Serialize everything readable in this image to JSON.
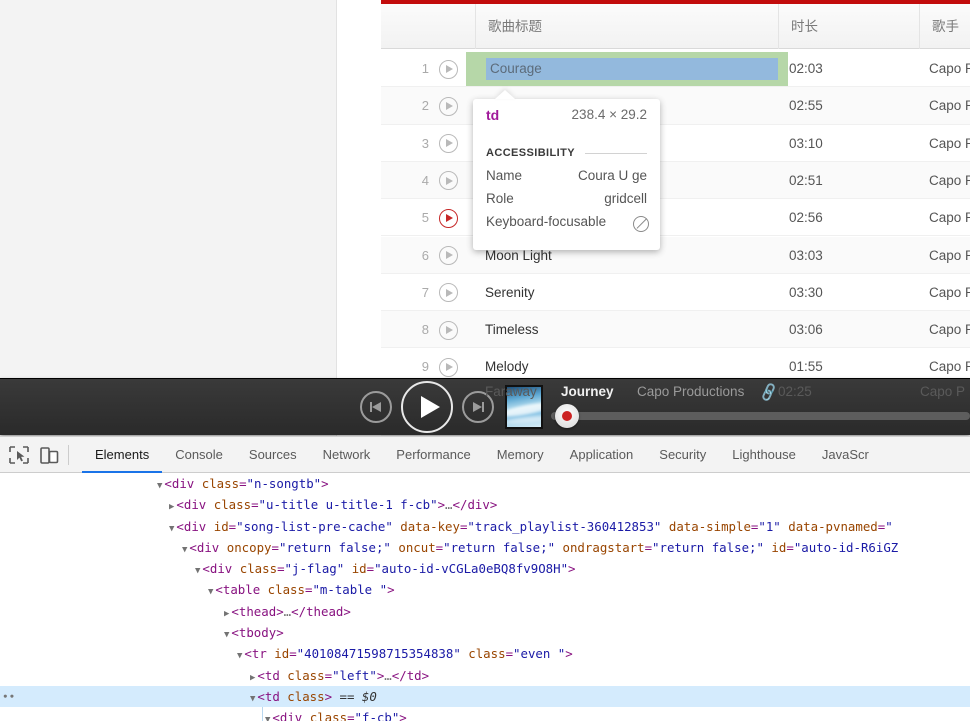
{
  "page": {
    "accent_red": "#c20c0c",
    "table": {
      "columns": [
        "",
        "歌曲标题",
        "时长",
        "歌手"
      ],
      "rows": [
        {
          "index": "1",
          "title": "Courage",
          "time": "02:03",
          "artist": "Capo P",
          "playing": false
        },
        {
          "index": "2",
          "title": "",
          "time": "02:55",
          "artist": "Capo P",
          "playing": false
        },
        {
          "index": "3",
          "title": "",
          "time": "03:10",
          "artist": "Capo P",
          "playing": false
        },
        {
          "index": "4",
          "title": "",
          "time": "02:51",
          "artist": "Capo P",
          "playing": false
        },
        {
          "index": "5",
          "title": "",
          "time": "02:56",
          "artist": "Capo P",
          "playing": true
        },
        {
          "index": "6",
          "title": "Moon Light",
          "time": "03:03",
          "artist": "Capo P",
          "playing": false
        },
        {
          "index": "7",
          "title": "Serenity",
          "time": "03:30",
          "artist": "Capo P",
          "playing": false
        },
        {
          "index": "8",
          "title": "Timeless",
          "time": "03:06",
          "artist": "Capo P",
          "playing": false
        },
        {
          "index": "9",
          "title": "Melody",
          "time": "01:55",
          "artist": "Capo P",
          "playing": false
        }
      ],
      "obscured_row": {
        "title": "Faraway",
        "time": "02:25",
        "artist": "Capo P"
      }
    },
    "highlight": {
      "selected_cell_text": "Courage",
      "padding_color": "#b6d7a8",
      "content_color": "#93b9dd"
    }
  },
  "tooltip": {
    "tag": "td",
    "dimensions": "238.4 × 29.2",
    "section_label": "ACCESSIBILITY",
    "rows": [
      {
        "key": "Name",
        "value": "Coura U ge"
      },
      {
        "key": "Role",
        "value": "gridcell"
      },
      {
        "key": "Keyboard-focusable",
        "value": ""
      }
    ]
  },
  "player": {
    "prev_label": "previous-track",
    "play_label": "play",
    "next_label": "next-track",
    "now_playing_title": "Journey",
    "now_playing_artist": "Capo Productions",
    "link_icon": "🔗"
  },
  "devtools": {
    "icons": [
      "inspect-element-icon",
      "device-toolbar-icon"
    ],
    "tabs": [
      {
        "label": "Elements",
        "active": true
      },
      {
        "label": "Console",
        "active": false
      },
      {
        "label": "Sources",
        "active": false
      },
      {
        "label": "Network",
        "active": false
      },
      {
        "label": "Performance",
        "active": false
      },
      {
        "label": "Memory",
        "active": false
      },
      {
        "label": "Application",
        "active": false
      },
      {
        "label": "Security",
        "active": false
      },
      {
        "label": "Lighthouse",
        "active": false
      },
      {
        "label": "JavaScr",
        "active": false
      }
    ],
    "dom_lines": [
      {
        "indent": 157,
        "twisty": "open",
        "html": "<span class=\"punc\">&lt;</span><span class=\"tag\">div</span> <span class=\"attr\">class</span><span class=\"punc\">=</span><span class=\"val\">\"n-songtb\"</span><span class=\"punc\">&gt;</span>",
        "selected": false,
        "gut": ""
      },
      {
        "indent": 169,
        "twisty": "closed",
        "html": "<span class=\"punc\">&lt;</span><span class=\"tag\">div</span> <span class=\"attr\">class</span><span class=\"punc\">=</span><span class=\"val\">\"u-title u-title-1 f-cb\"</span><span class=\"punc\">&gt;</span><span class=\"ell\">…</span><span class=\"punc\">&lt;/</span><span class=\"tag\">div</span><span class=\"punc\">&gt;</span>",
        "selected": false,
        "gut": ""
      },
      {
        "indent": 169,
        "twisty": "open",
        "html": "<span class=\"punc\">&lt;</span><span class=\"tag\">div</span> <span class=\"attr\">id</span><span class=\"punc\">=</span><span class=\"val\">\"song-list-pre-cache\"</span> <span class=\"attr\">data-key</span><span class=\"punc\">=</span><span class=\"val\">\"track_playlist-360412853\"</span> <span class=\"attr\">data-simple</span><span class=\"punc\">=</span><span class=\"val\">\"1\"</span> <span class=\"attr\">data-pvnamed</span><span class=\"punc\">=</span><span class=\"val\">\"</span>",
        "selected": false,
        "gut": ""
      },
      {
        "indent": 182,
        "twisty": "open",
        "html": "<span class=\"punc\">&lt;</span><span class=\"tag\">div</span> <span class=\"attr\">oncopy</span><span class=\"punc\">=</span><span class=\"val\">\"return false;\"</span> <span class=\"attr\">oncut</span><span class=\"punc\">=</span><span class=\"val\">\"return false;\"</span> <span class=\"attr\">ondragstart</span><span class=\"punc\">=</span><span class=\"val\">\"return false;\"</span> <span class=\"attr\">id</span><span class=\"punc\">=</span><span class=\"val\">\"auto-id-R6iGZ</span>",
        "selected": false,
        "gut": ""
      },
      {
        "indent": 195,
        "twisty": "open",
        "html": "<span class=\"punc\">&lt;</span><span class=\"tag\">div</span> <span class=\"attr\">class</span><span class=\"punc\">=</span><span class=\"val\">\"j-flag\"</span> <span class=\"attr\">id</span><span class=\"punc\">=</span><span class=\"val\">\"auto-id-vCGLa0eBQ8fv9O8H\"</span><span class=\"punc\">&gt;</span>",
        "selected": false,
        "gut": ""
      },
      {
        "indent": 208,
        "twisty": "open",
        "html": "<span class=\"punc\">&lt;</span><span class=\"tag\">table</span> <span class=\"attr\">class</span><span class=\"punc\">=</span><span class=\"val\">\"m-table \"</span><span class=\"punc\">&gt;</span>",
        "selected": false,
        "gut": ""
      },
      {
        "indent": 224,
        "twisty": "closed",
        "html": "<span class=\"punc\">&lt;</span><span class=\"tag\">thead</span><span class=\"punc\">&gt;</span><span class=\"ell\">…</span><span class=\"punc\">&lt;/</span><span class=\"tag\">thead</span><span class=\"punc\">&gt;</span>",
        "selected": false,
        "gut": ""
      },
      {
        "indent": 224,
        "twisty": "open",
        "html": "<span class=\"punc\">&lt;</span><span class=\"tag\">tbody</span><span class=\"punc\">&gt;</span>",
        "selected": false,
        "gut": ""
      },
      {
        "indent": 237,
        "twisty": "open",
        "html": "<span class=\"punc\">&lt;</span><span class=\"tag\">tr</span> <span class=\"attr\">id</span><span class=\"punc\">=</span><span class=\"val\">\"40108471598715354838\"</span> <span class=\"attr\">class</span><span class=\"punc\">=</span><span class=\"val\">\"even \"</span><span class=\"punc\">&gt;</span>",
        "selected": false,
        "gut": ""
      },
      {
        "indent": 250,
        "twisty": "closed",
        "html": "<span class=\"punc\">&lt;</span><span class=\"tag\">td</span> <span class=\"attr\">class</span><span class=\"punc\">=</span><span class=\"val\">\"left\"</span><span class=\"punc\">&gt;</span><span class=\"ell\">…</span><span class=\"punc\">&lt;/</span><span class=\"tag\">td</span><span class=\"punc\">&gt;</span>",
        "selected": false,
        "gut": ""
      },
      {
        "indent": 250,
        "twisty": "open",
        "html": "<span class=\"punc\">&lt;</span><span class=\"tag\">td</span> <span class=\"attr\">class</span><span class=\"punc\">&gt;</span> <span class=\"dollar\">== $0</span>",
        "selected": true,
        "gut": "∙∙"
      },
      {
        "indent": 265,
        "twisty": "open",
        "html": "<span class=\"punc\">&lt;</span><span class=\"tag\">div</span> <span class=\"attr\">class</span><span class=\"punc\">=</span><span class=\"val\">\"f-cb\"</span><span class=\"punc\">&gt;</span>",
        "selected": false,
        "gut": ""
      }
    ]
  }
}
